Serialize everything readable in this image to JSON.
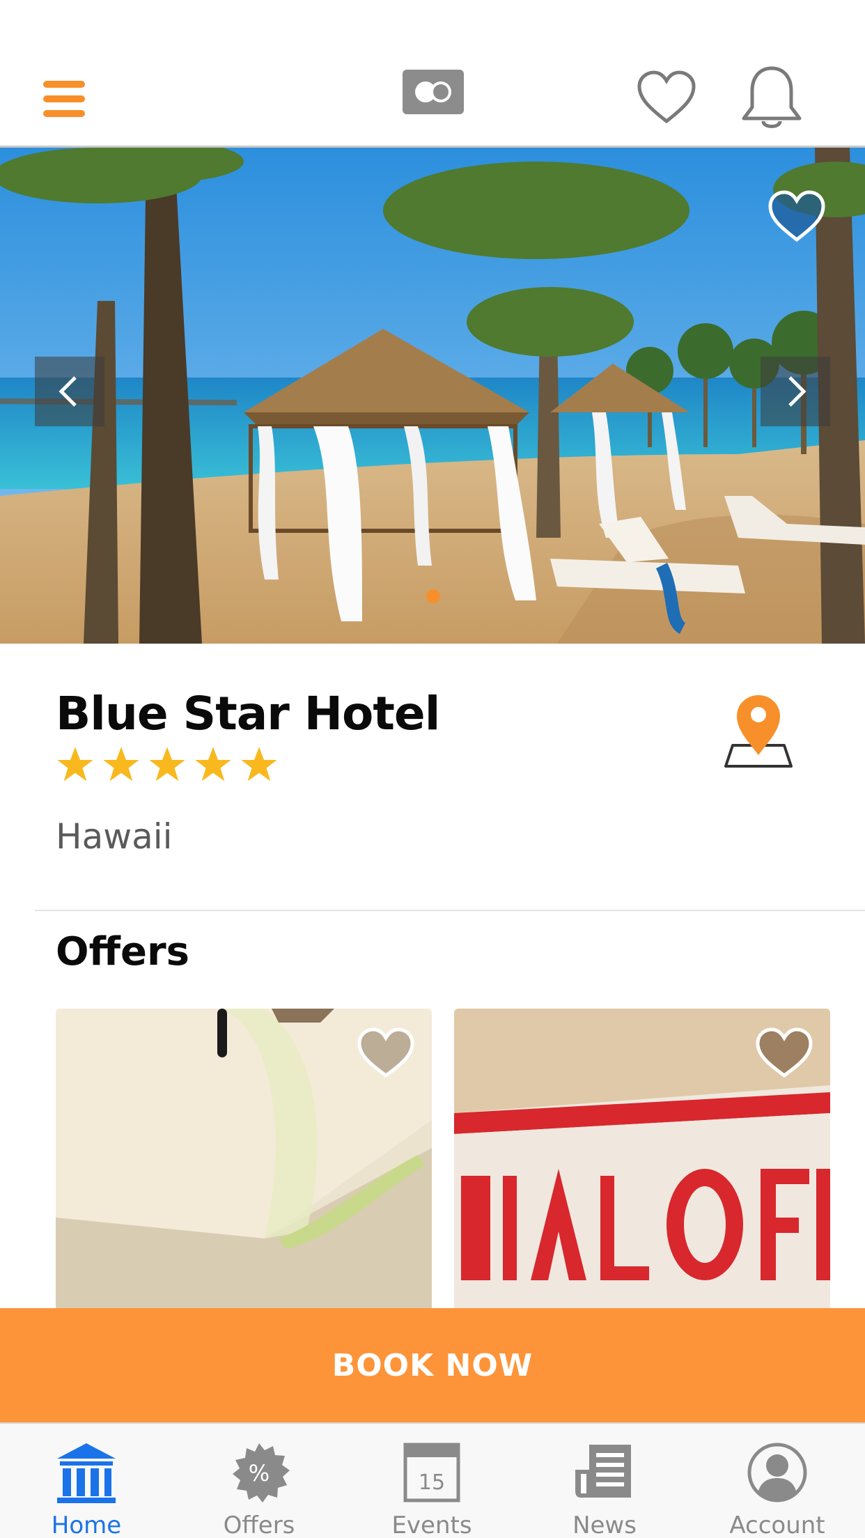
{
  "header": {
    "menu_icon": "hamburger-icon",
    "logo_icon": "toggle-logo-icon",
    "favorites_icon": "heart-icon",
    "notifications_icon": "bell-icon"
  },
  "hero": {
    "image": "beach-resort-photo",
    "favorite_icon": "heart-icon",
    "prev_icon": "chevron-left-icon",
    "next_icon": "chevron-right-icon",
    "slides_total": 1,
    "slide_active": 1
  },
  "hotel": {
    "name": "Blue Star Hotel",
    "rating": 5,
    "location": "Hawaii",
    "map_icon": "map-pin-icon"
  },
  "offers": {
    "title": "Offers",
    "items": [
      {
        "image": "gift-box-photo",
        "favorite_icon": "heart-icon"
      },
      {
        "image": "special-offer-stamp-photo",
        "favorite_icon": "heart-icon"
      }
    ]
  },
  "book": {
    "label": "BOOK NOW"
  },
  "tabs": [
    {
      "label": "Home",
      "icon": "home-columns-icon",
      "active": true
    },
    {
      "label": "Offers",
      "icon": "percent-badge-icon",
      "active": false
    },
    {
      "label": "Events",
      "icon": "calendar-icon",
      "active": false
    },
    {
      "label": "News",
      "icon": "newspaper-icon",
      "active": false
    },
    {
      "label": "Account",
      "icon": "user-icon",
      "active": false
    }
  ],
  "calendar_day": "15",
  "colors": {
    "accent": "#f7902a",
    "book_button": "#fd9439",
    "active_tab": "#1a73e8",
    "star": "#f8b81e"
  }
}
